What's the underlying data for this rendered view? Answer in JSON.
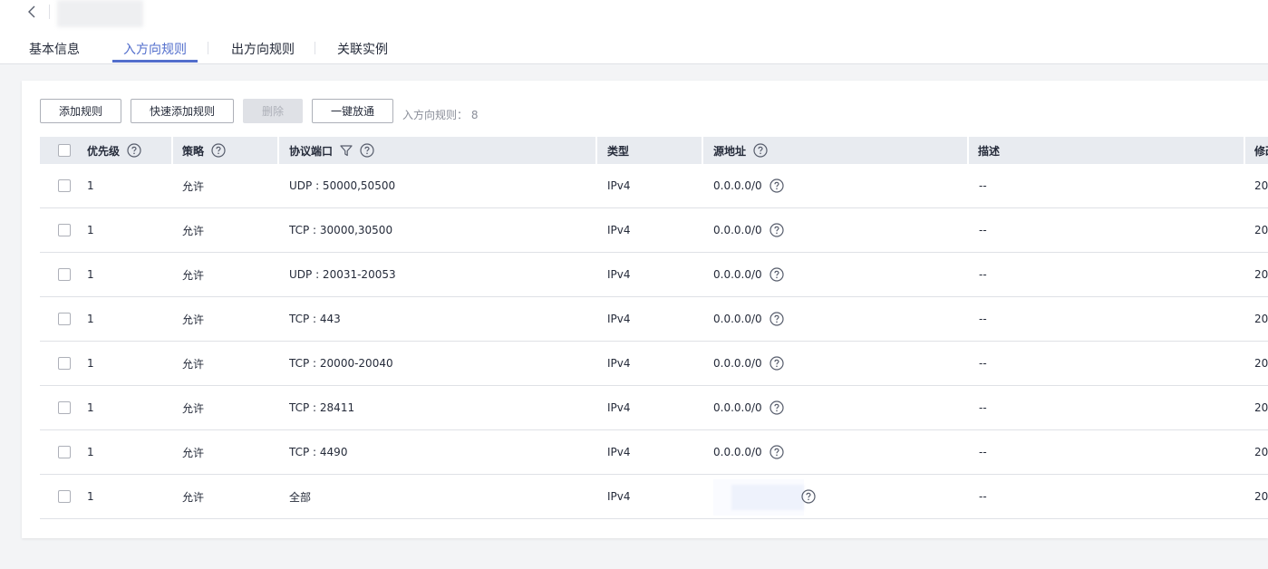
{
  "tabs": [
    {
      "label": "基本信息"
    },
    {
      "label": "入方向规则"
    },
    {
      "label": "出方向规则"
    },
    {
      "label": "关联实例"
    }
  ],
  "toolbar": {
    "add_rule": "添加规则",
    "quick_add_rule": "快速添加规则",
    "delete": "删除",
    "one_click_allow": "一键放通",
    "rule_count_label": "入方向规则：",
    "rule_count": "8"
  },
  "table": {
    "columns": {
      "priority": "优先级",
      "policy": "策略",
      "protocol_port": "协议端口",
      "type": "类型",
      "source": "源地址",
      "description": "描述",
      "modified": "修改"
    },
    "rows": [
      {
        "priority": "1",
        "policy": "允许",
        "protocol_port": "UDP : 50000,50500",
        "type": "IPv4",
        "source": "0.0.0.0/0",
        "description": "--",
        "modified": "20"
      },
      {
        "priority": "1",
        "policy": "允许",
        "protocol_port": "TCP : 30000,30500",
        "type": "IPv4",
        "source": "0.0.0.0/0",
        "description": "--",
        "modified": "20"
      },
      {
        "priority": "1",
        "policy": "允许",
        "protocol_port": "UDP : 20031-20053",
        "type": "IPv4",
        "source": "0.0.0.0/0",
        "description": "--",
        "modified": "20"
      },
      {
        "priority": "1",
        "policy": "允许",
        "protocol_port": "TCP : 443",
        "type": "IPv4",
        "source": "0.0.0.0/0",
        "description": "--",
        "modified": "20"
      },
      {
        "priority": "1",
        "policy": "允许",
        "protocol_port": "TCP : 20000-20040",
        "type": "IPv4",
        "source": "0.0.0.0/0",
        "description": "--",
        "modified": "20"
      },
      {
        "priority": "1",
        "policy": "允许",
        "protocol_port": "TCP : 28411",
        "type": "IPv4",
        "source": "0.0.0.0/0",
        "description": "--",
        "modified": "20"
      },
      {
        "priority": "1",
        "policy": "允许",
        "protocol_port": "TCP : 4490",
        "type": "IPv4",
        "source": "0.0.0.0/0",
        "description": "--",
        "modified": "20"
      },
      {
        "priority": "1",
        "policy": "允许",
        "protocol_port": "全部",
        "type": "IPv4",
        "source": "",
        "description": "--",
        "modified": "20"
      }
    ]
  },
  "colors": {
    "accent": "#526ecc",
    "header_bg": "#e8ebf0",
    "border": "#dfe1e6"
  }
}
